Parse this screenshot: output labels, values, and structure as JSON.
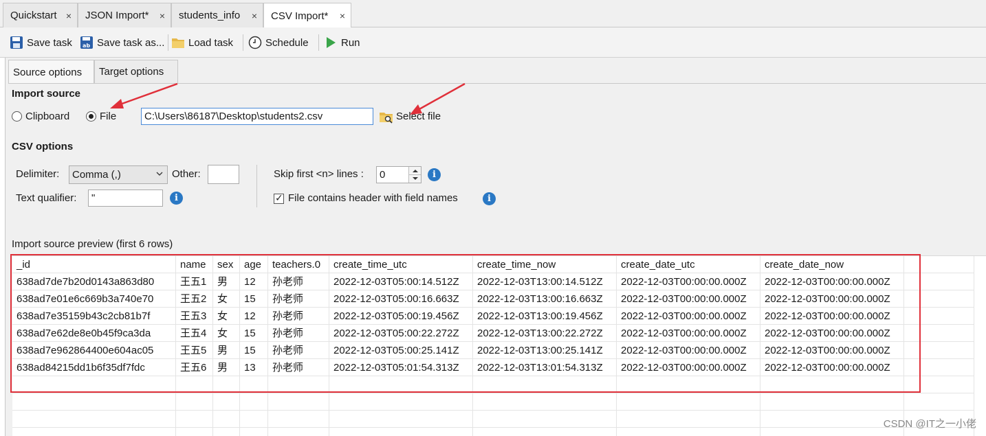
{
  "tabs": [
    {
      "label": "Quickstart"
    },
    {
      "label": "JSON Import*"
    },
    {
      "label": "students_info"
    },
    {
      "label": "CSV Import*"
    }
  ],
  "tab_close_glyph": "×",
  "toolbar": {
    "save_task": "Save task",
    "save_task_as": "Save task as...",
    "load_task": "Load task",
    "schedule": "Schedule",
    "run": "Run"
  },
  "inner_tabs": {
    "source": "Source options",
    "target": "Target options"
  },
  "import_source": {
    "heading": "Import source",
    "clipboard": "Clipboard",
    "file": "File",
    "selected": "File",
    "file_path": "C:\\Users\\86187\\Desktop\\students2.csv",
    "select_file": "Select file"
  },
  "csv_options": {
    "heading": "CSV options",
    "delimiter_label": "Delimiter:",
    "delimiter_value": "Comma (,)",
    "other_label": "Other:",
    "other_value": "",
    "text_qualifier_label": "Text qualifier:",
    "text_qualifier_value": "\"",
    "skip_label": "Skip first <n> lines :",
    "skip_value": "0",
    "header_label": "File contains header with field names",
    "header_checked": true,
    "info_glyph": "i"
  },
  "preview": {
    "label": "Import source preview (first 6 rows)",
    "columns": [
      "_id",
      "name",
      "sex",
      "age",
      "teachers.0",
      "create_time_utc",
      "create_time_now",
      "create_date_utc",
      "create_date_now"
    ],
    "rows": [
      [
        "638ad7de7b20d0143a863d80",
        "王五1",
        "男",
        "12",
        "孙老师",
        "2022-12-03T05:00:14.512Z",
        "2022-12-03T13:00:14.512Z",
        "2022-12-03T00:00:00.000Z",
        "2022-12-03T00:00:00.000Z"
      ],
      [
        "638ad7e01e6c669b3a740e70",
        "王五2",
        "女",
        "15",
        "孙老师",
        "2022-12-03T05:00:16.663Z",
        "2022-12-03T13:00:16.663Z",
        "2022-12-03T00:00:00.000Z",
        "2022-12-03T00:00:00.000Z"
      ],
      [
        "638ad7e35159b43c2cb81b7f",
        "王五3",
        "女",
        "12",
        "孙老师",
        "2022-12-03T05:00:19.456Z",
        "2022-12-03T13:00:19.456Z",
        "2022-12-03T00:00:00.000Z",
        "2022-12-03T00:00:00.000Z"
      ],
      [
        "638ad7e62de8e0b45f9ca3da",
        "王五4",
        "女",
        "15",
        "孙老师",
        "2022-12-03T05:00:22.272Z",
        "2022-12-03T13:00:22.272Z",
        "2022-12-03T00:00:00.000Z",
        "2022-12-03T00:00:00.000Z"
      ],
      [
        "638ad7e962864400e604ac05",
        "王五5",
        "男",
        "15",
        "孙老师",
        "2022-12-03T05:00:25.141Z",
        "2022-12-03T13:00:25.141Z",
        "2022-12-03T00:00:00.000Z",
        "2022-12-03T00:00:00.000Z"
      ],
      [
        "638ad84215dd1b6f35df7fdc",
        "王五6",
        "男",
        "13",
        "孙老师",
        "2022-12-03T05:01:54.313Z",
        "2022-12-03T13:01:54.313Z",
        "2022-12-03T00:00:00.000Z",
        "2022-12-03T00:00:00.000Z"
      ]
    ]
  },
  "watermark": "CSDN @IT之一小佬",
  "colors": {
    "annotation_red": "#e0303a",
    "info_blue": "#2a78c4",
    "run_green": "#3aa54a"
  },
  "icons": {
    "save": "floppy-disk-icon",
    "save_as": "floppy-disk-ab-icon",
    "load": "folder-icon",
    "schedule": "clock-icon",
    "run": "play-icon",
    "select_file": "folder-search-icon",
    "info": "info-icon"
  }
}
